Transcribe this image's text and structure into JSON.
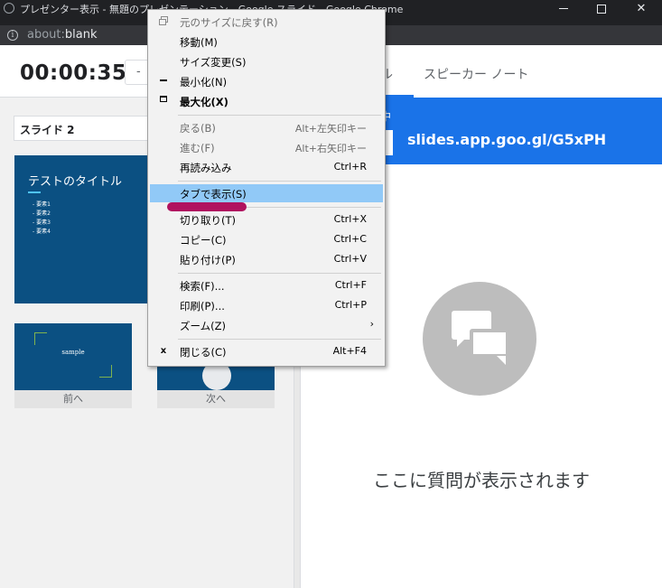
{
  "window": {
    "title": "プレゼンター表示 - 無題のプレゼンテーション - Google スライド - Google Chrome",
    "address_prefix": "about:",
    "address_host": "blank"
  },
  "presenter": {
    "timer": "00:00:35",
    "timer_button_label": "-",
    "slide_selector": "スライド 2",
    "main_slide": {
      "title": "テストのタイトル",
      "bullets": [
        "要素1",
        "要素2",
        "要素3",
        "要素4"
      ]
    },
    "prev_thumb_text": "sample",
    "prev_label": "前へ",
    "next_label": "次へ"
  },
  "right_panel": {
    "tabs": [
      {
        "label": "ル"
      },
      {
        "label": "スピーカー ノート"
      }
    ],
    "banner_status": "中",
    "banner_link": "slides.app.goo.gl/G5xPH",
    "empty_message": "ここに質問が表示されます"
  },
  "context_menu": {
    "items": [
      {
        "label": "元のサイズに戻す(R)",
        "accel": "",
        "disabled": true,
        "icon": "restore-icon"
      },
      {
        "label": "移動(M)",
        "accel": ""
      },
      {
        "label": "サイズ変更(S)",
        "accel": ""
      },
      {
        "label": "最小化(N)",
        "accel": "",
        "icon": "minimize-icon"
      },
      {
        "label": "最大化(X)",
        "accel": "",
        "bold": true,
        "icon": "maximize-icon"
      },
      {
        "label": "戻る(B)",
        "accel": "Alt+左矢印キー",
        "disabled": true
      },
      {
        "label": "進む(F)",
        "accel": "Alt+右矢印キー",
        "disabled": true
      },
      {
        "label": "再読み込み",
        "accel": "Ctrl+R"
      },
      {
        "label": "タブで表示(S)",
        "accel": "",
        "highlighted": true
      },
      {
        "label": "切り取り(T)",
        "accel": "Ctrl+X"
      },
      {
        "label": "コピー(C)",
        "accel": "Ctrl+C"
      },
      {
        "label": "貼り付け(P)",
        "accel": "Ctrl+V"
      },
      {
        "label": "検索(F)...",
        "accel": "Ctrl+F"
      },
      {
        "label": "印刷(P)...",
        "accel": "Ctrl+P"
      },
      {
        "label": "ズーム(Z)",
        "accel": "",
        "submenu_arrow": "›"
      },
      {
        "label": "閉じる(C)",
        "accel": "Alt+F4",
        "icon": "close-icon",
        "icon_glyph": "x"
      }
    ]
  },
  "colors": {
    "slide_bg": "#0b5082",
    "accent_blue": "#1a73e8",
    "menu_highlight": "#91c9f7",
    "annotation": "#b0125f"
  }
}
